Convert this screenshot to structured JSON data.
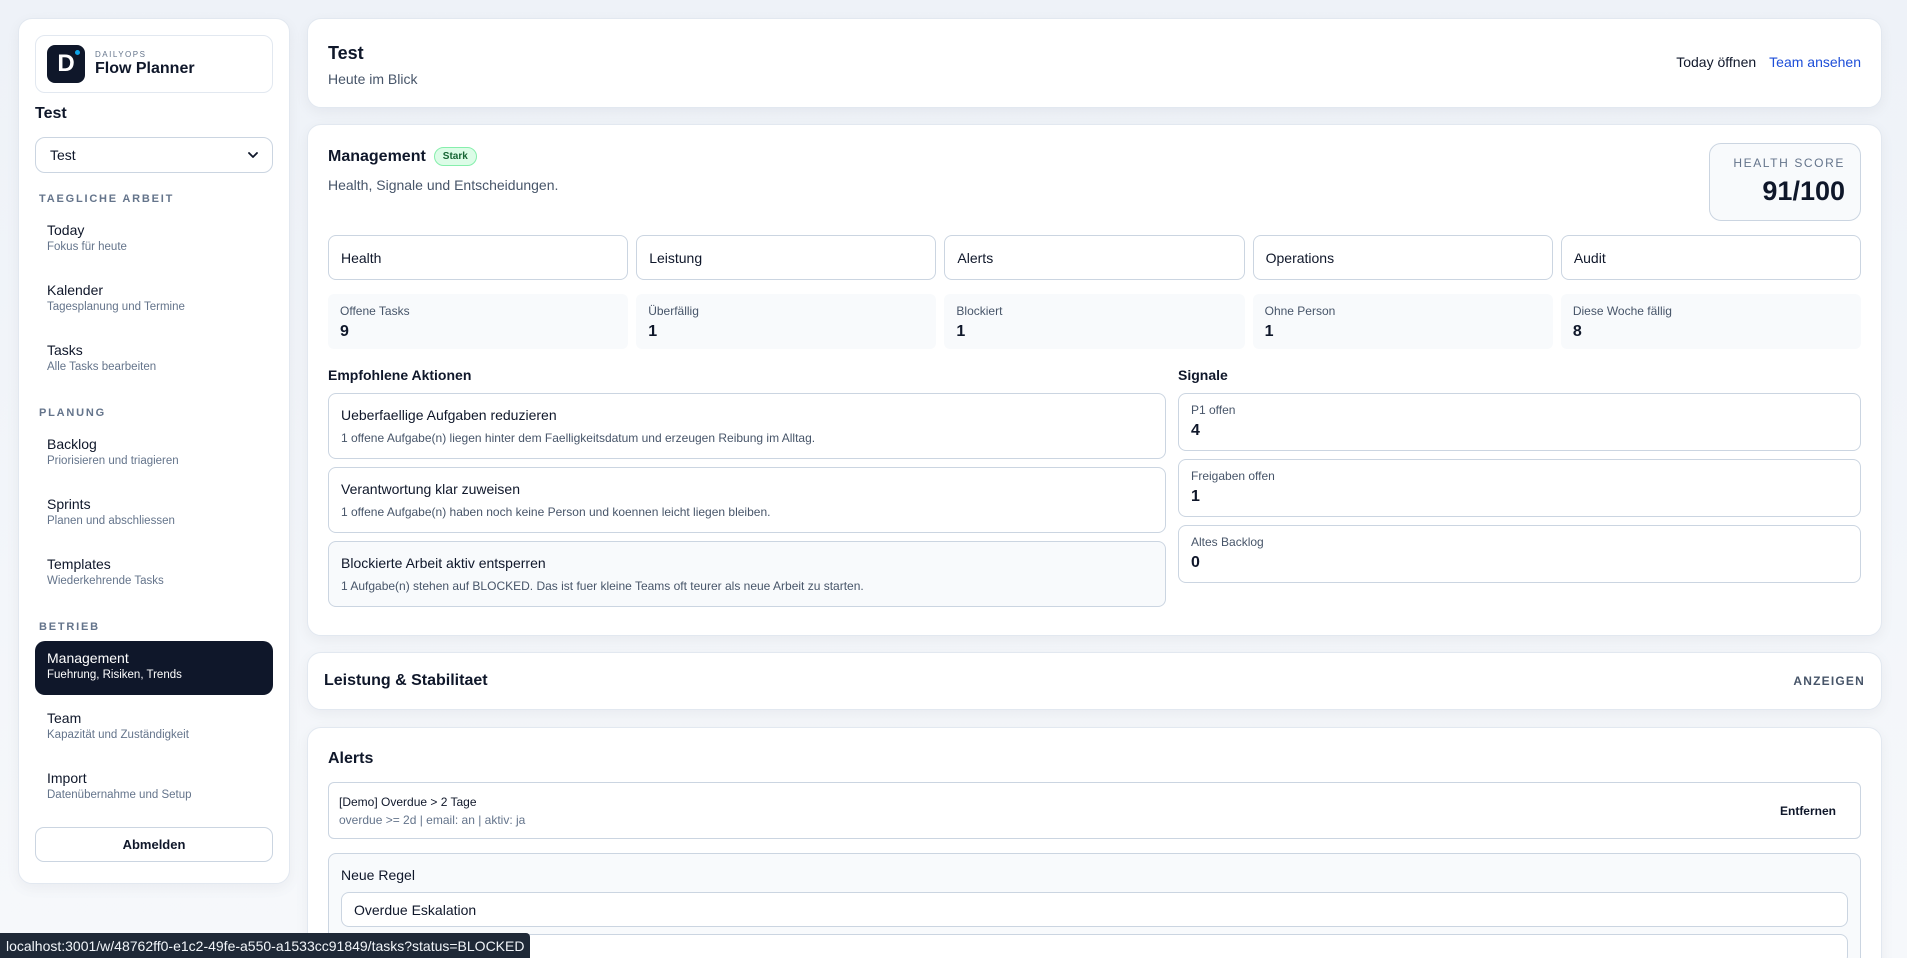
{
  "sidebar": {
    "brand_kicker": "DAILYOPS",
    "brand_name": "Flow Planner",
    "logo_letter": "D",
    "workspace_title": "Test",
    "workspace_select": "Test",
    "sections": [
      {
        "title": "TAEGLICHE ARBEIT",
        "items": [
          {
            "label": "Today",
            "sub": "Fokus für heute"
          },
          {
            "label": "Kalender",
            "sub": "Tagesplanung und Termine"
          },
          {
            "label": "Tasks",
            "sub": "Alle Tasks bearbeiten"
          }
        ]
      },
      {
        "title": "PLANUNG",
        "items": [
          {
            "label": "Backlog",
            "sub": "Priorisieren und triagieren"
          },
          {
            "label": "Sprints",
            "sub": "Planen und abschliessen"
          },
          {
            "label": "Templates",
            "sub": "Wiederkehrende Tasks"
          }
        ]
      },
      {
        "title": "BETRIEB",
        "items": [
          {
            "label": "Management",
            "sub": "Fuehrung, Risiken, Trends"
          },
          {
            "label": "Team",
            "sub": "Kapazität und Zuständigkeit"
          },
          {
            "label": "Import",
            "sub": "Datenübernahme und Setup"
          }
        ]
      }
    ],
    "logout_label": "Abmelden"
  },
  "topbar": {
    "title": "Test",
    "subtitle": "Heute im Blick",
    "action_today": "Today öffnen",
    "action_team": "Team ansehen"
  },
  "management": {
    "title": "Management",
    "badge": "Stark",
    "subtitle": "Health, Signale und Entscheidungen.",
    "health_label": "HEALTH SCORE",
    "health_value": "91/100",
    "tabs": [
      "Health",
      "Leistung",
      "Alerts",
      "Operations",
      "Audit"
    ],
    "stats": [
      {
        "label": "Offene Tasks",
        "value": "9"
      },
      {
        "label": "Überfällig",
        "value": "1"
      },
      {
        "label": "Blockiert",
        "value": "1"
      },
      {
        "label": "Ohne Person",
        "value": "1"
      },
      {
        "label": "Diese Woche fällig",
        "value": "8"
      }
    ],
    "actions_title": "Empfohlene Aktionen",
    "actions": [
      {
        "title": "Ueberfaellige Aufgaben reduzieren",
        "desc": "1 offene Aufgabe(n) liegen hinter dem Faelligkeitsdatum und erzeugen Reibung im Alltag."
      },
      {
        "title": "Verantwortung klar zuweisen",
        "desc": "1 offene Aufgabe(n) haben noch keine Person und koennen leicht liegen bleiben."
      },
      {
        "title": "Blockierte Arbeit aktiv entsperren",
        "desc": "1 Aufgabe(n) stehen auf BLOCKED. Das ist fuer kleine Teams oft teurer als neue Arbeit zu starten."
      }
    ],
    "signals_title": "Signale",
    "signals": [
      {
        "label": "P1 offen",
        "value": "4"
      },
      {
        "label": "Freigaben offen",
        "value": "1"
      },
      {
        "label": "Altes Backlog",
        "value": "0"
      }
    ]
  },
  "performance": {
    "title": "Leistung & Stabilitaet",
    "toggle": "ANZEIGEN"
  },
  "alerts": {
    "title": "Alerts",
    "rule_name": "[Demo] Overdue > 2 Tage",
    "rule_meta": "overdue >= 2d | email: an | aktiv: ja",
    "remove_label": "Entfernen",
    "new_rule_title": "Neue Regel",
    "new_rule_value": "Overdue Eskalation"
  },
  "statusbar": {
    "url": "localhost:3001/w/48762ff0-e1c2-49fe-a550-a1533cc91849/tasks?status=BLOCKED"
  }
}
